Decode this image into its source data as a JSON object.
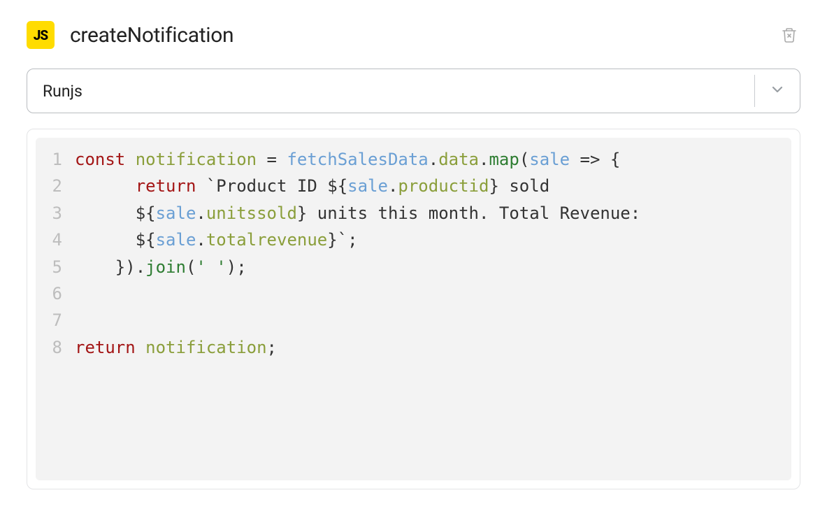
{
  "header": {
    "badge_text": "JS",
    "title": "createNotification"
  },
  "dropdown": {
    "selected": "Runjs"
  },
  "code": {
    "lines": [
      {
        "n": "1",
        "tokens": [
          {
            "t": "const ",
            "c": "tok-kw"
          },
          {
            "t": "notification",
            "c": "tok-var"
          },
          {
            "t": " = ",
            "c": "tok-punct"
          },
          {
            "t": "fetchSalesData",
            "c": "tok-param"
          },
          {
            "t": ".",
            "c": "tok-punct"
          },
          {
            "t": "data",
            "c": "tok-prop"
          },
          {
            "t": ".",
            "c": "tok-punct"
          },
          {
            "t": "map",
            "c": "tok-func"
          },
          {
            "t": "(",
            "c": "tok-punct"
          },
          {
            "t": "sale",
            "c": "tok-param"
          },
          {
            "t": " => {",
            "c": "tok-punct"
          }
        ]
      },
      {
        "n": "2",
        "tokens": [
          {
            "t": "      ",
            "c": ""
          },
          {
            "t": "return",
            "c": "tok-kw"
          },
          {
            "t": " `Product ID ",
            "c": "tok-text"
          },
          {
            "t": "$",
            "c": "tok-interp"
          },
          {
            "t": "{",
            "c": "tok-punct"
          },
          {
            "t": "sale",
            "c": "tok-param"
          },
          {
            "t": ".",
            "c": "tok-punct"
          },
          {
            "t": "productid",
            "c": "tok-prop"
          },
          {
            "t": "}",
            "c": "tok-punct"
          },
          {
            "t": " sold",
            "c": "tok-text"
          }
        ]
      },
      {
        "n": "3",
        "tokens": [
          {
            "t": "      ",
            "c": ""
          },
          {
            "t": "$",
            "c": "tok-interp"
          },
          {
            "t": "{",
            "c": "tok-punct"
          },
          {
            "t": "sale",
            "c": "tok-param"
          },
          {
            "t": ".",
            "c": "tok-punct"
          },
          {
            "t": "unitssold",
            "c": "tok-prop"
          },
          {
            "t": "}",
            "c": "tok-punct"
          },
          {
            "t": " units this month. Total Revenue:",
            "c": "tok-text"
          }
        ]
      },
      {
        "n": "4",
        "tokens": [
          {
            "t": "      ",
            "c": ""
          },
          {
            "t": "$",
            "c": "tok-interp"
          },
          {
            "t": "{",
            "c": "tok-punct"
          },
          {
            "t": "sale",
            "c": "tok-param"
          },
          {
            "t": ".",
            "c": "tok-punct"
          },
          {
            "t": "totalrevenue",
            "c": "tok-prop"
          },
          {
            "t": "}",
            "c": "tok-punct"
          },
          {
            "t": "`;",
            "c": "tok-punct"
          }
        ]
      },
      {
        "n": "5",
        "tokens": [
          {
            "t": "    }).",
            "c": "tok-punct"
          },
          {
            "t": "join",
            "c": "tok-func"
          },
          {
            "t": "(",
            "c": "tok-punct"
          },
          {
            "t": "' '",
            "c": "tok-string"
          },
          {
            "t": ");",
            "c": "tok-punct"
          }
        ]
      },
      {
        "n": "6",
        "tokens": []
      },
      {
        "n": "7",
        "tokens": []
      },
      {
        "n": "8",
        "tokens": [
          {
            "t": "return ",
            "c": "tok-kw"
          },
          {
            "t": "notification",
            "c": "tok-var"
          },
          {
            "t": ";",
            "c": "tok-punct"
          }
        ]
      }
    ]
  }
}
